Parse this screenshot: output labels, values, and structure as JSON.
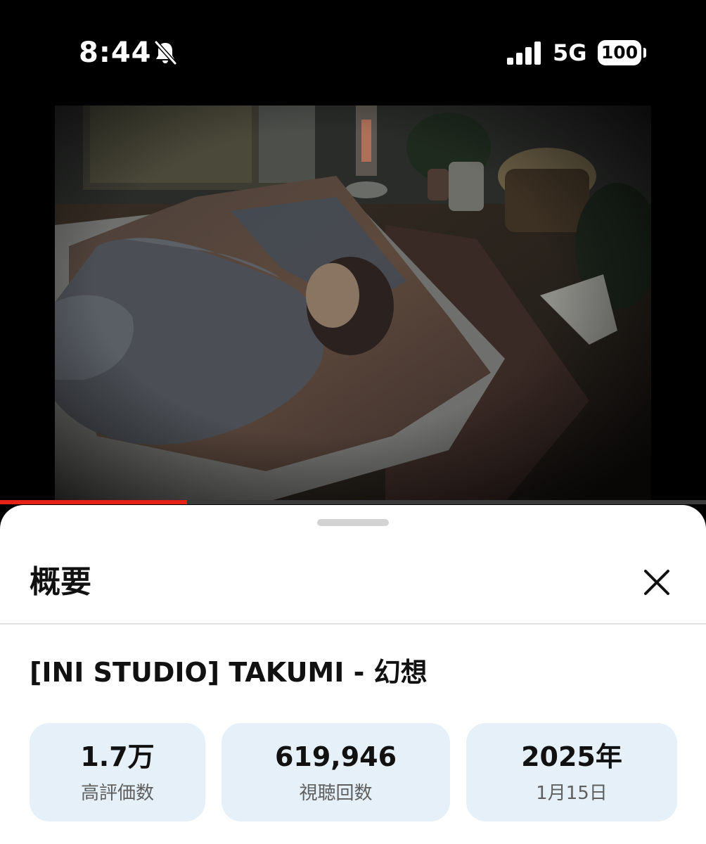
{
  "status_bar": {
    "time": "8:44",
    "network": "5G",
    "battery": "100"
  },
  "video": {
    "progress_fraction": 0.265
  },
  "sheet": {
    "title": "概要",
    "video_title": "[INI STUDIO] TAKUMI - 幻想",
    "stats": [
      {
        "value": "1.7万",
        "label": "高評価数"
      },
      {
        "value": "619,946",
        "label": "視聴回数"
      },
      {
        "value": "2025年",
        "label": "1月15日"
      }
    ]
  },
  "icons": {
    "bell": "bell-slash-icon",
    "signal": "cellular-signal-icon",
    "close": "close-icon"
  },
  "colors": {
    "progress": "#e62117",
    "stat_card_bg": "#e6f0f8",
    "sheet_bg": "#ffffff"
  }
}
